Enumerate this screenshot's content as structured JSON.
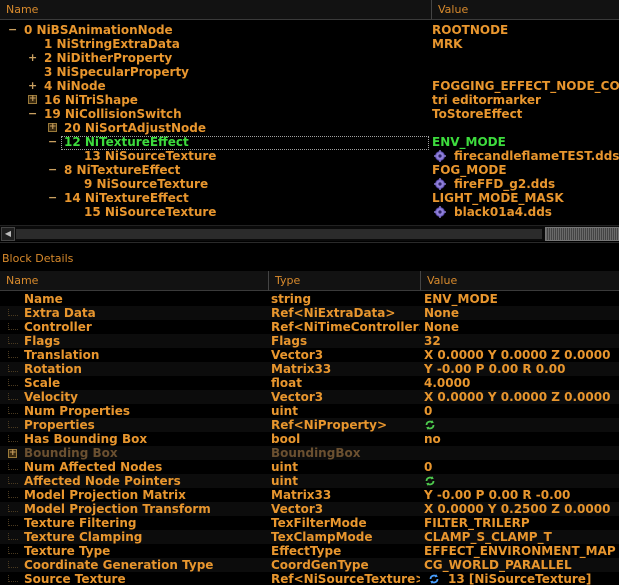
{
  "tree": {
    "headers": {
      "name": "Name",
      "value": "Value"
    },
    "rows": [
      {
        "name": "0 NiBSAnimationNode",
        "value": "ROOTNODE",
        "indent": 0,
        "expander": "minus"
      },
      {
        "name": "1 NiStringExtraData",
        "value": "MRK",
        "indent": 1,
        "expander": "none"
      },
      {
        "name": "2 NiDitherProperty",
        "value": "",
        "indent": 1,
        "expander": "plus"
      },
      {
        "name": "3 NiSpecularProperty",
        "value": "",
        "indent": 1,
        "expander": "none"
      },
      {
        "name": "4 NiNode",
        "value": "FOGGING_EFFECT_NODE_CONTR",
        "indent": 1,
        "expander": "plus"
      },
      {
        "name": "16 NiTriShape",
        "value": "tri editormarker",
        "indent": 1,
        "expander": "boxed"
      },
      {
        "name": "19 NiCollisionSwitch",
        "value": "ToStoreEffect",
        "indent": 1,
        "expander": "minus"
      },
      {
        "name": "20 NiSortAdjustNode",
        "value": "",
        "indent": 2,
        "expander": "boxed"
      },
      {
        "name": "12 NiTextureEffect",
        "value": "ENV_MODE",
        "indent": 2,
        "expander": "minus",
        "selected": true
      },
      {
        "name": "13 NiSourceTexture",
        "value": "firecandleflameTEST.dds",
        "indent": 3,
        "expander": "none",
        "icon": "gear"
      },
      {
        "name": "8 NiTextureEffect",
        "value": "FOG_MODE",
        "indent": 2,
        "expander": "minus"
      },
      {
        "name": "9 NiSourceTexture",
        "value": "fireFFD_g2.dds",
        "indent": 3,
        "expander": "none",
        "icon": "gear"
      },
      {
        "name": "14 NiTextureEffect",
        "value": "LIGHT_MODE_MASK",
        "indent": 2,
        "expander": "minus"
      },
      {
        "name": "15 NiSourceTexture",
        "value": "black01a4.dds",
        "indent": 3,
        "expander": "none",
        "icon": "gear"
      }
    ]
  },
  "details": {
    "title": "Block Details",
    "headers": {
      "name": "Name",
      "type": "Type",
      "value": "Value"
    },
    "rows": [
      {
        "name": "Name",
        "type": "string",
        "value": "ENV_MODE"
      },
      {
        "name": "Extra Data",
        "type": "Ref<NiExtraData>",
        "value": "None"
      },
      {
        "name": "Controller",
        "type": "Ref<NiTimeController>",
        "value": "None"
      },
      {
        "name": "Flags",
        "type": "Flags",
        "value": "32"
      },
      {
        "name": "Translation",
        "type": "Vector3",
        "value": "X 0.0000 Y 0.0000 Z 0.0000"
      },
      {
        "name": "Rotation",
        "type": "Matrix33",
        "value": "Y -0.00 P 0.00 R 0.00"
      },
      {
        "name": "Scale",
        "type": "float",
        "value": "4.0000"
      },
      {
        "name": "Velocity",
        "type": "Vector3",
        "value": "X 0.0000 Y 0.0000 Z 0.0000"
      },
      {
        "name": "Num Properties",
        "type": "uint",
        "value": "0"
      },
      {
        "name": "Properties",
        "type": "Ref<NiProperty>",
        "value": "",
        "icon": "cycle"
      },
      {
        "name": "Has Bounding Box",
        "type": "bool",
        "value": "no"
      },
      {
        "name": "Bounding Box",
        "type": "BoundingBox",
        "value": "",
        "dim": true,
        "expander": true
      },
      {
        "name": "Num Affected Nodes",
        "type": "uint",
        "value": "0"
      },
      {
        "name": "Affected Node Pointers",
        "type": "uint",
        "value": "",
        "icon": "cycle"
      },
      {
        "name": "Model Projection Matrix",
        "type": "Matrix33",
        "value": "Y -0.00 P 0.00 R -0.00"
      },
      {
        "name": "Model Projection Transform",
        "type": "Vector3",
        "value": "X 0.0000 Y 0.2500 Z 0.0000"
      },
      {
        "name": "Texture Filtering",
        "type": "TexFilterMode",
        "value": "FILTER_TRILERP"
      },
      {
        "name": "Texture Clamping",
        "type": "TexClampMode",
        "value": "CLAMP_S_CLAMP_T"
      },
      {
        "name": "Texture Type",
        "type": "EffectType",
        "value": "EFFECT_ENVIRONMENT_MAP"
      },
      {
        "name": "Coordinate Generation Type",
        "type": "CoordGenType",
        "value": "CG_WORLD_PARALLEL"
      },
      {
        "name": "Source Texture",
        "type": "Ref<NiSourceTexture>",
        "value": "13 [NiSourceTexture]",
        "icon": "cycle-blue"
      }
    ]
  },
  "colors": {
    "accent": "#e8962e",
    "selected": "#3ddc3d",
    "background": "#000000",
    "dim": "#6b5030"
  }
}
